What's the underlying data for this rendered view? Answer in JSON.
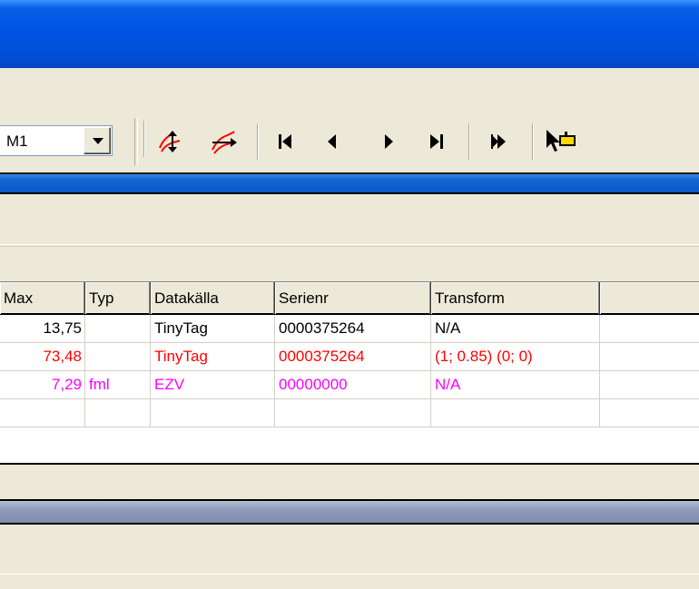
{
  "toolbar": {
    "combo_value": "M1",
    "icons": [
      "link-channels-icon",
      "unlink-channels-icon",
      "first-icon",
      "previous-icon",
      "next-icon",
      "last-icon",
      "fast-forward-icon",
      "pointer-select-icon"
    ]
  },
  "grid": {
    "columns": [
      "Max",
      "Typ",
      "Datakälla",
      "Serienr",
      "Transform",
      ""
    ],
    "rows": [
      {
        "max": "13,75",
        "typ": "",
        "source": "TinyTag",
        "serial": "0000375264",
        "transform": "N/A",
        "color": "#000000"
      },
      {
        "max": "73,48",
        "typ": "",
        "source": "TinyTag",
        "serial": "0000375264",
        "transform": "(1; 0.85) (0; 0)",
        "color": "#ff0000"
      },
      {
        "max": "7,29",
        "typ": "fml",
        "source": "EZV",
        "serial": "00000000",
        "transform": "N/A",
        "color": "#ff00ff"
      },
      {
        "max": "",
        "typ": "",
        "source": "",
        "serial": "",
        "transform": "",
        "color": "#000000"
      }
    ]
  },
  "colors": {
    "title_blue": "#0054e3",
    "face": "#ece9d8",
    "red": "#ff0000",
    "magenta": "#ff00ff"
  }
}
